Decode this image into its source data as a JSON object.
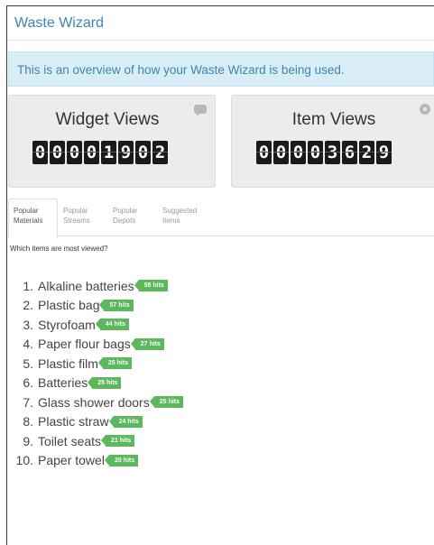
{
  "header": {
    "title": "Waste Wizard"
  },
  "info": {
    "text": "This is an overview of how your Waste Wizard is being used."
  },
  "stats": {
    "widget_views": {
      "title": "Widget Views",
      "digits": [
        "0",
        "0",
        "0",
        "0",
        "1",
        "9",
        "0",
        "2"
      ],
      "icon": "comment-icon"
    },
    "item_views": {
      "title": "Item Views",
      "digits": [
        "0",
        "0",
        "0",
        "0",
        "3",
        "6",
        "2",
        "9"
      ],
      "icon": "eye-icon"
    }
  },
  "tabs": [
    {
      "line1": "Popular",
      "line2": "Materials",
      "active": true
    },
    {
      "line1": "Popular",
      "line2": "Streams",
      "active": false
    },
    {
      "line1": "Popular",
      "line2": "Depots",
      "active": false
    },
    {
      "line1": "Suggested",
      "line2": "Items",
      "active": false
    }
  ],
  "question": "Which items are most viewed?",
  "items": [
    {
      "num": "1.",
      "name": "Alkaline batteries",
      "hits": "58 hits"
    },
    {
      "num": "2.",
      "name": "Plastic bag",
      "hits": "57 hits"
    },
    {
      "num": "3.",
      "name": "Styrofoam",
      "hits": "44 hits"
    },
    {
      "num": "4.",
      "name": "Paper flour bags",
      "hits": "27 hits"
    },
    {
      "num": "5.",
      "name": "Plastic film",
      "hits": "25 hits"
    },
    {
      "num": "6.",
      "name": "Batteries",
      "hits": "25 hits"
    },
    {
      "num": "7.",
      "name": "Glass shower doors",
      "hits": "25 hits"
    },
    {
      "num": "8.",
      "name": "Plastic straw",
      "hits": "24 hits"
    },
    {
      "num": "9.",
      "name": "Toilet seats",
      "hits": "21 hits"
    },
    {
      "num": "10.",
      "name": "Paper towel",
      "hits": "20 hits"
    }
  ],
  "colors": {
    "accent": "#3a87ad",
    "info_bg": "#d9edf7",
    "badge": "#5cb85c",
    "panel_bg": "#ececec"
  }
}
